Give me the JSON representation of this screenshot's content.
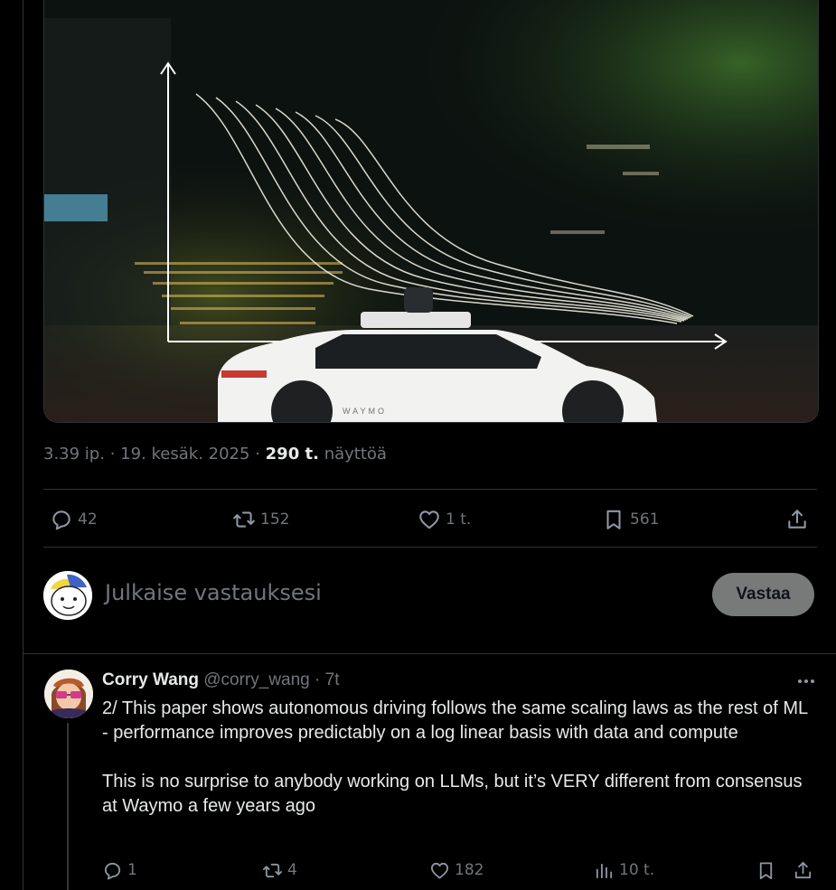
{
  "tweet": {
    "media": {
      "brand_text": "WAYMO"
    },
    "meta": {
      "time": "3.39 ip.",
      "separator": "·",
      "date": "19. kesäk. 2025",
      "views_count": "290 t.",
      "views_label": "näyttöä"
    },
    "actions": {
      "replies": "42",
      "reposts": "152",
      "likes": "1 t.",
      "bookmarks": "561"
    },
    "icons": {
      "reply": "reply-icon",
      "repost": "repost-icon",
      "like": "heart-icon",
      "bookmark": "bookmark-icon",
      "share": "share-icon"
    }
  },
  "composer": {
    "placeholder": "Julkaise vastauksesi",
    "reply_button": "Vastaa"
  },
  "reply_tweet": {
    "name": "Corry Wang",
    "handle": "@corry_wang",
    "separator": "·",
    "time": "7t",
    "body": [
      "2/ This paper shows autonomous driving follows the same scaling laws as the rest of ML - performance improves predictably on a log linear basis with data and compute",
      "This is no surprise to anybody working on LLMs, but it’s VERY different from consensus at Waymo a few years ago"
    ],
    "actions": {
      "replies": "1",
      "reposts": "4",
      "likes": "182",
      "views": "10 t."
    }
  },
  "colors": {
    "background": "#000000",
    "text": "#e7e9ea",
    "muted": "#71767b",
    "border": "#2f3336",
    "reply_button_bg": "#787a7a"
  }
}
